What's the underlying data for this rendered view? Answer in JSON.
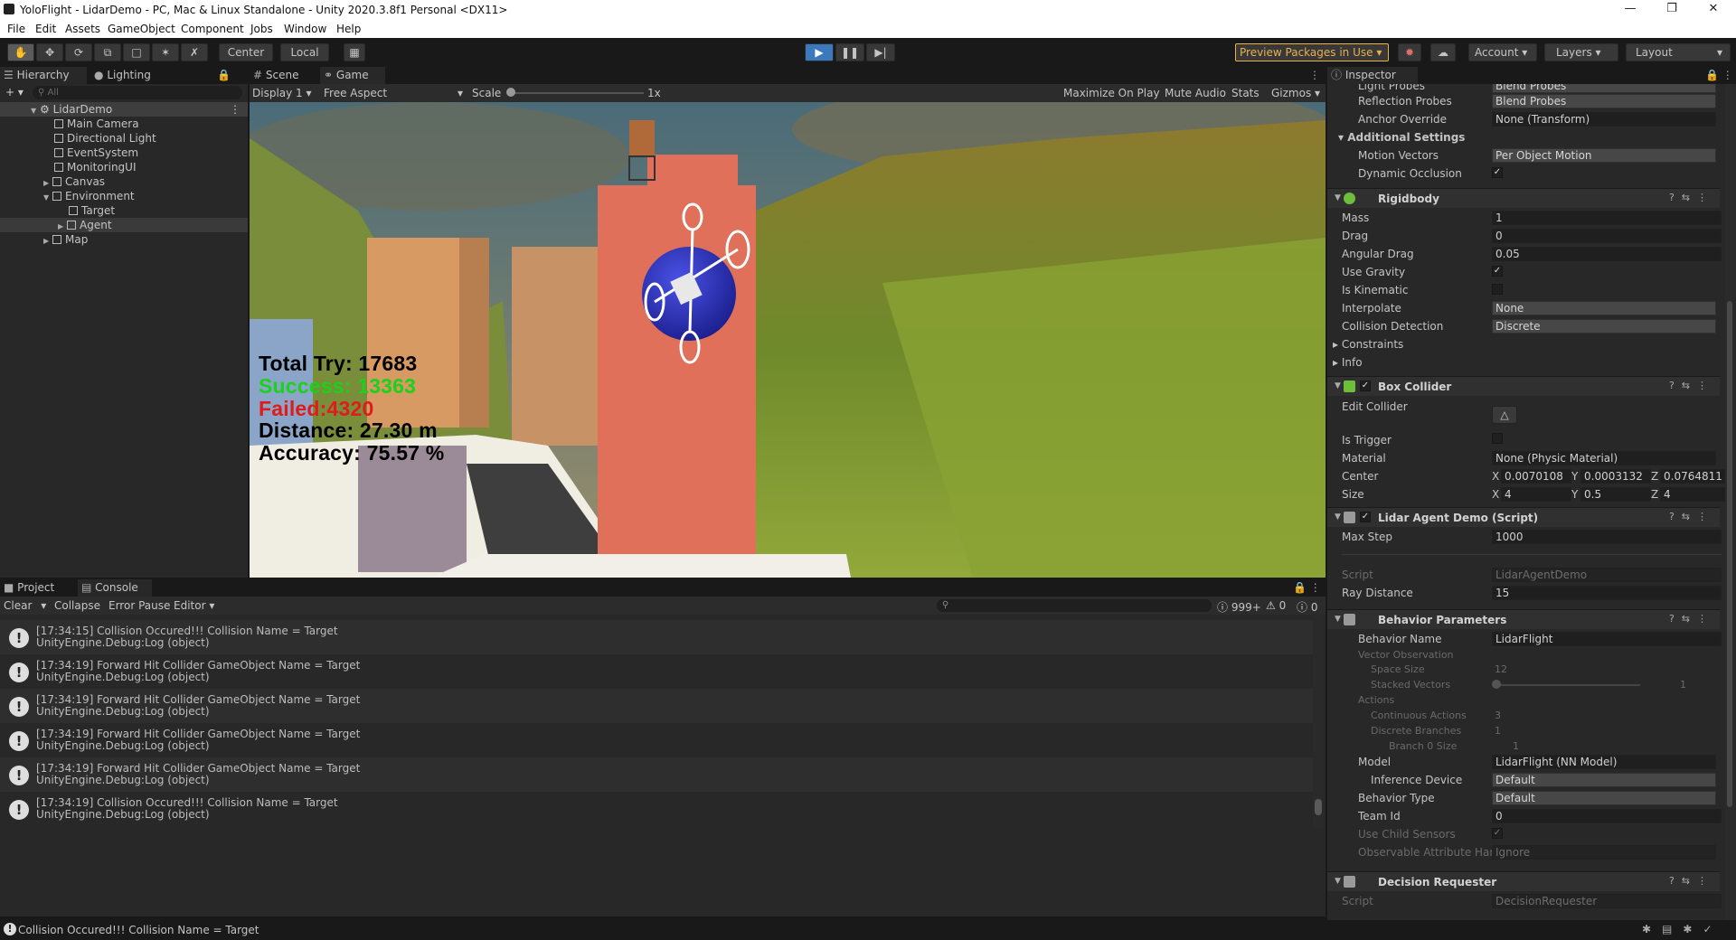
{
  "window": {
    "title": "YoloFlight - LidarDemo - PC, Mac & Linux Standalone - Unity 2020.3.8f1 Personal <DX11>"
  },
  "menu": [
    "File",
    "Edit",
    "Assets",
    "GameObject",
    "Component",
    "Jobs",
    "Window",
    "Help"
  ],
  "toolbar": {
    "center": "Center",
    "local": "Local",
    "preview": "Preview Packages in Use",
    "account": "Account",
    "layers": "Layers",
    "layout": "Layout"
  },
  "hierarchy": {
    "tabs": {
      "hierarchy": "Hierarchy",
      "lighting": "Lighting"
    },
    "search_placeholder": "All",
    "scene": "LidarDemo",
    "items": [
      "Main Camera",
      "Directional Light",
      "EventSystem",
      "MonitoringUI",
      "Canvas",
      "Environment",
      "Target",
      "Agent",
      "Map"
    ]
  },
  "game": {
    "tabs": {
      "scene": "Scene",
      "game": "Game"
    },
    "display": "Display 1",
    "aspect": "Free Aspect",
    "scale_label": "Scale",
    "scale_value": "1x",
    "maximize": "Maximize On Play",
    "mute": "Mute Audio",
    "stats": "Stats",
    "gizmos": "Gizmos",
    "hud": {
      "total": "Total Try: 17683",
      "success": "Success: 13363",
      "failed": "Failed:4320",
      "distance": "Distance: 27.30 m",
      "accuracy": "Accuracy: 75.57 %"
    },
    "colors": {
      "success": "#19d21a",
      "failed": "#e01b1b",
      "sphere": "#2a2fc4",
      "building": "#e0705a"
    }
  },
  "console": {
    "tabs": {
      "project": "Project",
      "console": "Console"
    },
    "buttons": {
      "clear": "Clear",
      "collapse": "Collapse",
      "error_pause": "Error Pause",
      "editor": "Editor"
    },
    "counts": {
      "info": "999+",
      "warn": "0",
      "error": "0"
    },
    "logs": [
      {
        "l1": "[17:34:15] Collision Occured!!! Collision Name = Target",
        "l2": "UnityEngine.Debug:Log (object)"
      },
      {
        "l1": "[17:34:19] Forward Hit Collider GameObject Name = Target",
        "l2": "UnityEngine.Debug:Log (object)"
      },
      {
        "l1": "[17:34:19] Forward Hit Collider GameObject Name = Target",
        "l2": "UnityEngine.Debug:Log (object)"
      },
      {
        "l1": "[17:34:19] Forward Hit Collider GameObject Name = Target",
        "l2": "UnityEngine.Debug:Log (object)"
      },
      {
        "l1": "[17:34:19] Forward Hit Collider GameObject Name = Target",
        "l2": "UnityEngine.Debug:Log (object)"
      },
      {
        "l1": "[17:34:19] Collision Occured!!! Collision Name = Target",
        "l2": "UnityEngine.Debug:Log (object)"
      }
    ]
  },
  "statusbar": {
    "message": "Collision Occured!!! Collision Name = Target"
  },
  "inspector": {
    "tab": "Inspector",
    "renderer": {
      "light_probes": "Light Probes",
      "light_probes_val": "Blend Probes",
      "reflection_probes": "Reflection Probes",
      "reflection_probes_val": "Blend Probes",
      "anchor_override": "Anchor Override",
      "anchor_override_val": "None (Transform)",
      "additional": "Additional Settings",
      "motion_vectors": "Motion Vectors",
      "motion_vectors_val": "Per Object Motion",
      "dynamic_occlusion": "Dynamic Occlusion"
    },
    "rigidbody": {
      "title": "Rigidbody",
      "mass": "Mass",
      "mass_val": "1",
      "drag": "Drag",
      "drag_val": "0",
      "angular_drag": "Angular Drag",
      "angular_drag_val": "0.05",
      "use_gravity": "Use Gravity",
      "is_kinematic": "Is Kinematic",
      "interpolate": "Interpolate",
      "interpolate_val": "None",
      "collision_detection": "Collision Detection",
      "collision_detection_val": "Discrete",
      "constraints": "Constraints",
      "info": "Info"
    },
    "box_collider": {
      "title": "Box Collider",
      "edit_collider": "Edit Collider",
      "is_trigger": "Is Trigger",
      "material": "Material",
      "material_val": "None (Physic Material)",
      "center": "Center",
      "cx": "0.0070108",
      "cy": "0.0003132",
      "cz": "0.0764811",
      "size": "Size",
      "sx": "4",
      "sy": "0.5",
      "sz": "4",
      "x": "X",
      "y": "Y",
      "z": "Z"
    },
    "lidar": {
      "title": "Lidar Agent Demo (Script)",
      "max_step": "Max Step",
      "max_step_val": "1000",
      "script": "Script",
      "script_val": "LidarAgentDemo",
      "ray_distance": "Ray Distance",
      "ray_distance_val": "15"
    },
    "behavior": {
      "title": "Behavior Parameters",
      "behavior_name": "Behavior Name",
      "behavior_name_val": "LidarFlight",
      "vector_observation": "Vector Observation",
      "space_size": "Space Size",
      "space_size_val": "12",
      "stacked_vectors": "Stacked Vectors",
      "stacked_vectors_val": "1",
      "actions": "Actions",
      "continuous_actions": "Continuous Actions",
      "continuous_actions_val": "3",
      "discrete_branches": "Discrete Branches",
      "discrete_branches_val": "1",
      "branch0": "Branch 0 Size",
      "branch0_val": "1",
      "model": "Model",
      "model_val": "LidarFlight (NN Model)",
      "inference_device": "Inference Device",
      "inference_device_val": "Default",
      "behavior_type": "Behavior Type",
      "behavior_type_val": "Default",
      "team_id": "Team Id",
      "team_id_val": "0",
      "use_child_sensors": "Use Child Sensors",
      "observable": "Observable Attribute Hand",
      "observable_val": "Ignore"
    },
    "decision": {
      "title": "Decision Requester",
      "script": "Script",
      "script_val": "DecisionRequester"
    }
  }
}
